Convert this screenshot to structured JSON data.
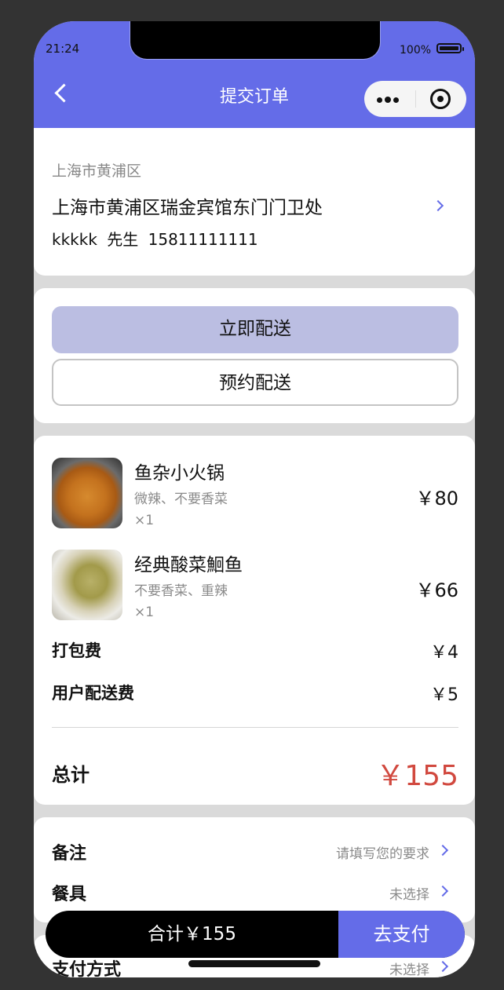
{
  "status_bar": {
    "time": "21:24",
    "battery": "100%"
  },
  "header": {
    "title": "提交订单"
  },
  "address": {
    "district": "上海市黄浦区",
    "detail": "上海市黄浦区瑞金宾馆东门门卫处",
    "contact": "kkkkk  先生  15811111111"
  },
  "delivery": {
    "now_label": "立即配送",
    "scheduled_label": "预约配送"
  },
  "items": [
    {
      "name": "鱼杂小火锅",
      "spec": "微辣、不要香菜",
      "qty": "×1",
      "price": "￥80"
    },
    {
      "name": "经典酸菜鮰鱼",
      "spec": "不要香菜、重辣",
      "qty": "×1",
      "price": "￥66"
    }
  ],
  "fees": {
    "packing_label": "打包费",
    "packing_value": "￥4",
    "delivery_label": "用户配送费",
    "delivery_value": "￥5"
  },
  "total": {
    "label": "总计",
    "value": "￥155"
  },
  "extras": {
    "remark_label": "备注",
    "remark_value": "请填写您的要求",
    "tableware_label": "餐具",
    "tableware_value": "未选择",
    "payment_label": "支付方式",
    "payment_value": "未选择"
  },
  "paybar": {
    "sum_label": "合计￥155",
    "pay_label": "去支付"
  },
  "colors": {
    "accent": "#646ce8",
    "price_red": "#d1493f",
    "selected_btn": "#bbbee2"
  }
}
